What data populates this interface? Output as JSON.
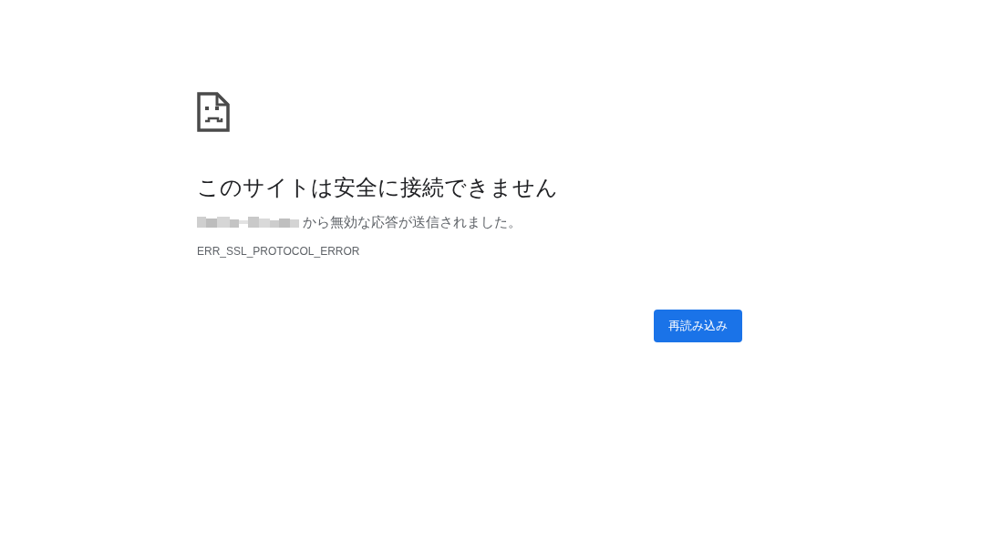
{
  "heading": "このサイトは安全に接続できません",
  "message": "から無効な応答が送信されました。",
  "error_code": "ERR_SSL_PROTOCOL_ERROR",
  "buttons": [
    {
      "label": "再読み込み",
      "kind": "primary"
    }
  ]
}
